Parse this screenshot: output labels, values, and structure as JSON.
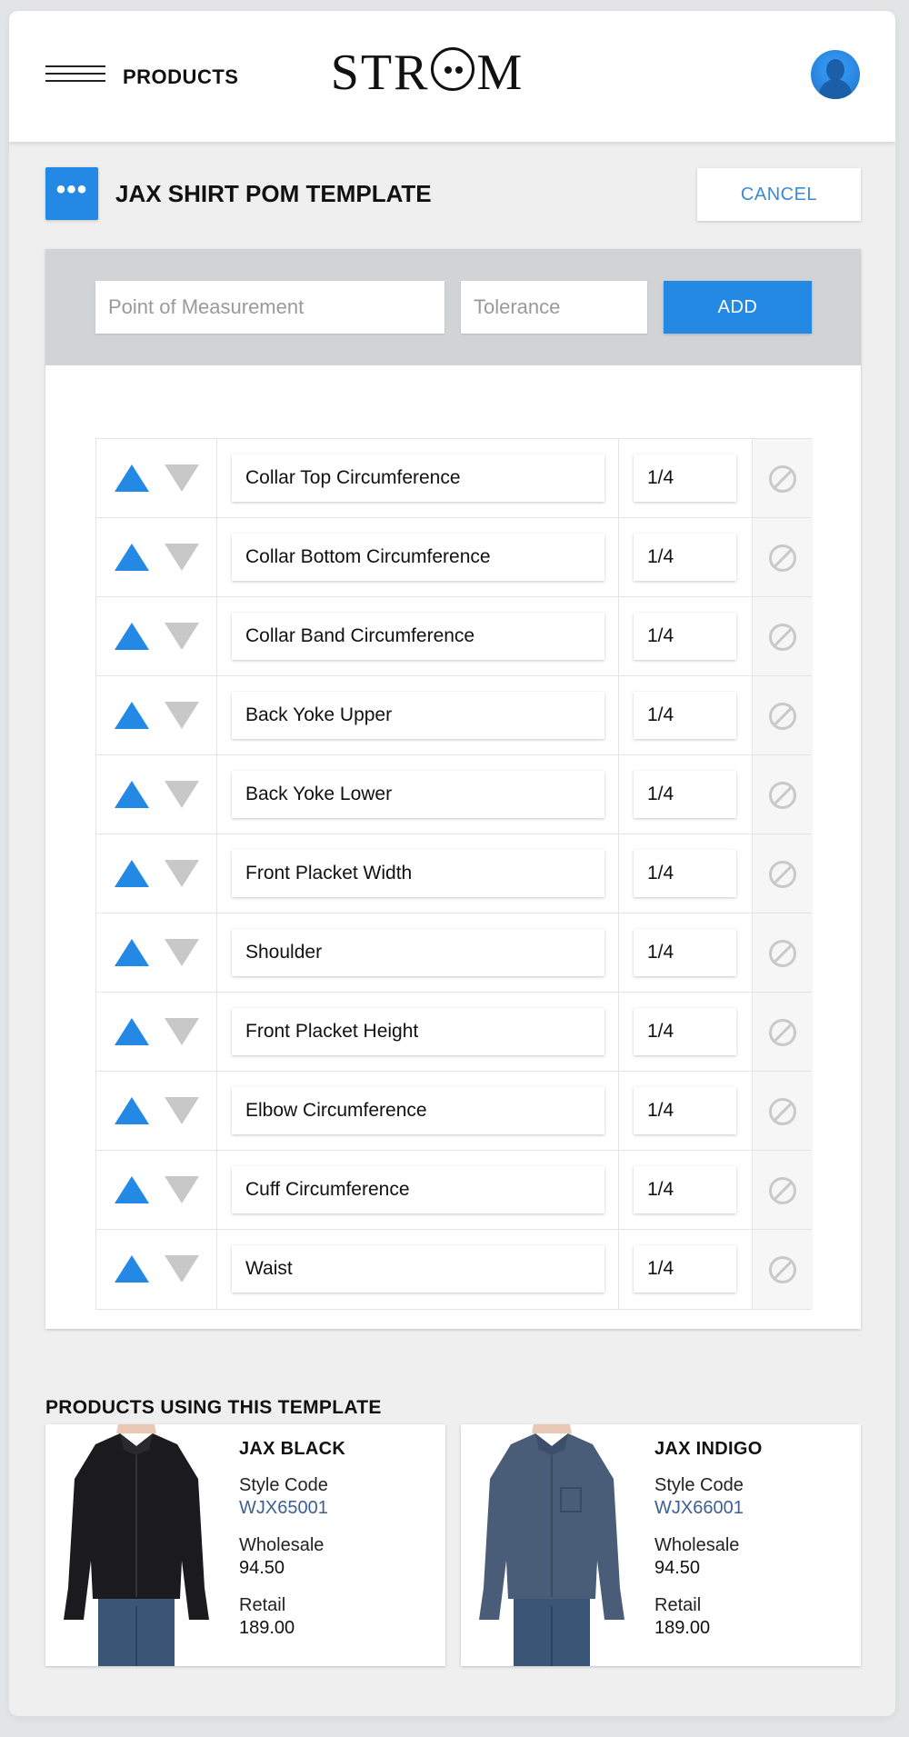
{
  "header": {
    "nav_title": "PRODUCTS",
    "logo": "STROM",
    "logo_left": "STR",
    "logo_right": "M"
  },
  "template": {
    "more_label": "•••",
    "title": "JAX SHIRT POM TEMPLATE",
    "cancel_label": "CANCEL"
  },
  "add_form": {
    "pom_placeholder": "Point of Measurement",
    "tolerance_placeholder": "Tolerance",
    "add_label": "ADD"
  },
  "poms": [
    {
      "name": "Collar Top Circumference",
      "tolerance": "1/4"
    },
    {
      "name": "Collar Bottom Circumference",
      "tolerance": "1/4"
    },
    {
      "name": "Collar Band Circumference",
      "tolerance": "1/4"
    },
    {
      "name": "Back Yoke Upper",
      "tolerance": "1/4"
    },
    {
      "name": "Back Yoke Lower",
      "tolerance": "1/4"
    },
    {
      "name": "Front Placket Width",
      "tolerance": "1/4"
    },
    {
      "name": "Shoulder",
      "tolerance": "1/4"
    },
    {
      "name": "Front Placket Height",
      "tolerance": "1/4"
    },
    {
      "name": "Elbow Circumference",
      "tolerance": "1/4"
    },
    {
      "name": "Cuff Circumference",
      "tolerance": "1/4"
    },
    {
      "name": "Waist",
      "tolerance": "1/4"
    }
  ],
  "products_section": {
    "title": "PRODUCTS USING THIS TEMPLATE",
    "style_code_label": "Style Code",
    "wholesale_label": "Wholesale",
    "retail_label": "Retail",
    "items": [
      {
        "name": "JAX BLACK",
        "style_code": "WJX65001",
        "wholesale": "94.50",
        "retail": "189.00",
        "shirt_color": "#1b1b1d"
      },
      {
        "name": "JAX INDIGO",
        "style_code": "WJX66001",
        "wholesale": "94.50",
        "retail": "189.00",
        "shirt_color": "#4a5d78"
      }
    ]
  },
  "colors": {
    "accent": "#2389e4",
    "muted_arrow": "#c8c8c8",
    "link": "#3a8ad6"
  }
}
